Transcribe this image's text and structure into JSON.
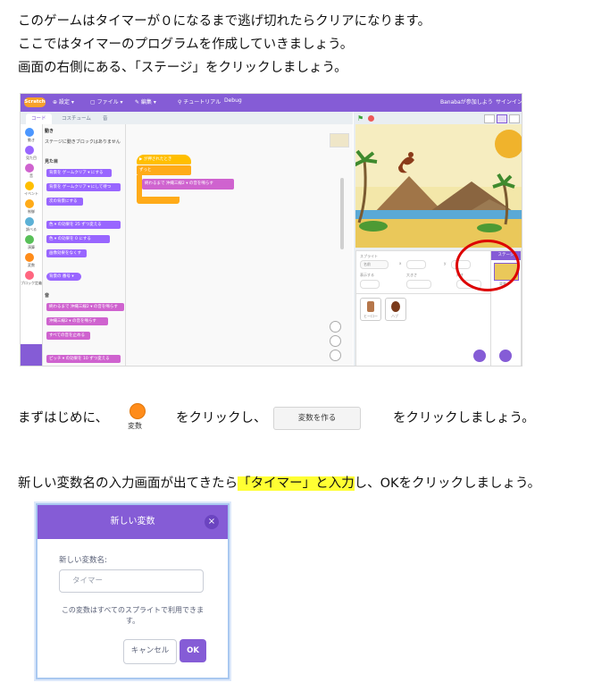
{
  "instructions": {
    "line1": "このゲームはタイマーが０になるまで逃げ切れたらクリアになります。",
    "line2": "ここではタイマーのプログラムを作成していきましょう。",
    "line3": "画面の右側にある、「ステージ」をクリックしましょう。",
    "step2_before": "まずはじめに、",
    "step2_mid": "をクリックし、",
    "step2_after": "をクリックしましょう。",
    "step3_before": "新しい変数名の入力画面が出てきたら",
    "step3_highlight": "「タイマー」と入力",
    "step3_after": "し、OKをクリックしましょう。"
  },
  "variables_button": {
    "label": "変数",
    "color": "#ff8c1a"
  },
  "make_variable_button": {
    "label": "変数を作る"
  },
  "scratch": {
    "logo": "Scratch",
    "menu": [
      "⊕ 設定 ▾",
      "▢ ファイル ▾",
      "✎ 編集 ▾",
      "⚲ チュートリアル",
      "Debug"
    ],
    "user": "Banabaが参加しよう",
    "signin": "サインイン",
    "tabs": [
      "コード",
      "コスチューム",
      "音"
    ],
    "categories": [
      {
        "label": "動き",
        "color": "#4c97ff"
      },
      {
        "label": "見た目",
        "color": "#9966ff"
      },
      {
        "label": "音",
        "color": "#cf63cf"
      },
      {
        "label": "イベント",
        "color": "#ffbf00"
      },
      {
        "label": "制御",
        "color": "#ffab19"
      },
      {
        "label": "調べる",
        "color": "#5cb1d6"
      },
      {
        "label": "演算",
        "color": "#59c059"
      },
      {
        "label": "変数",
        "color": "#ff8c1a"
      },
      {
        "label": "ブロック定義",
        "color": "#ff6680"
      }
    ],
    "palette": {
      "motion_head": "動き",
      "motion_note": "ステージに動きブロックはありません",
      "looks_head": "見た目",
      "sound_head": "音",
      "blocks": [
        "背景を ゲームクリア ▾ にする",
        "背景を ゲームクリア ▾ にして待つ",
        "次の背景にする",
        "色 ▾ の効果を 25 ずつ変える",
        "色 ▾ の効果を 0 にする",
        "画像効果をなくす",
        "背景の 番号 ▾",
        "終わるまで 沖縄三線2 ▾ の音を鳴らす",
        "沖縄三線2 ▾ の音を鳴らす",
        "すべての音を止める",
        "ピッチ ▾ の効果を 10 ずつ変える"
      ]
    },
    "script": {
      "hat": "▶ が押されたとき",
      "forever": "ずっと",
      "play": "終わるまで 沖縄三線2 ▾ の音を鳴らす"
    },
    "sprite_info": {
      "sprite_label": "スプライト",
      "name": "名前",
      "show": "表示する",
      "size": "大きさ",
      "direction": "向き",
      "x": "x",
      "y": "y"
    },
    "sprites": [
      "ヒーロー",
      "ハブ"
    ],
    "stage_panel": {
      "title": "ステージ",
      "backdrops": "背景"
    }
  },
  "dialog": {
    "title": "新しい変数",
    "close": "×",
    "name_label": "新しい変数名:",
    "input_placeholder": "タイマー",
    "note": "この変数はすべてのスプライトで利用できます。",
    "cancel": "キャンセル",
    "ok": "OK"
  }
}
